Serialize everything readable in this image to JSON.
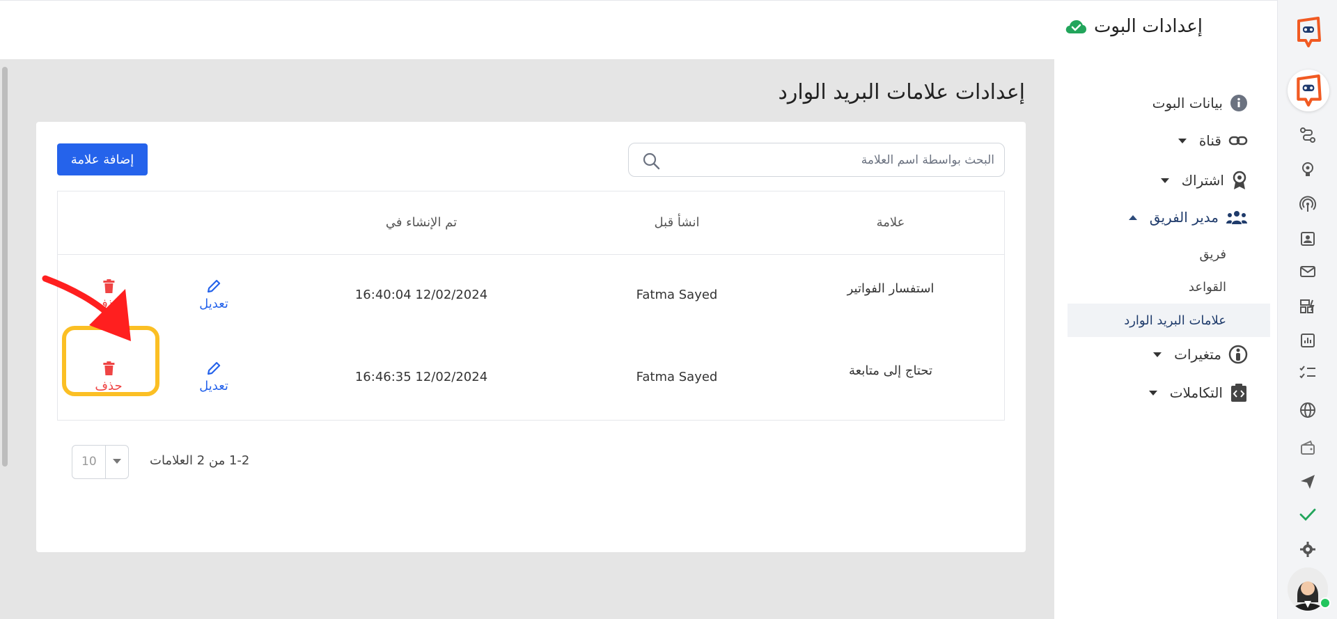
{
  "header": {
    "title": "إعدادات البوت"
  },
  "page": {
    "title": "إعدادات علامات البريد الوارد"
  },
  "toolbar": {
    "add_label": "إضافة علامة",
    "search_placeholder": "البحث بواسطة اسم العلامة"
  },
  "table": {
    "headers": {
      "label": "علامة",
      "created_by": "انشأ قبل",
      "created_at": "تم الإنشاء في"
    },
    "rows": [
      {
        "label": "استفسار الفواتير",
        "created_by": "Fatma Sayed",
        "created_at": "16:40:04 12/02/2024",
        "edit": "تعديل",
        "delete": "حذف"
      },
      {
        "label": "تحتاج إلى متابعة",
        "created_by": "Fatma Sayed",
        "created_at": "16:46:35 12/02/2024",
        "edit": "تعديل",
        "delete": "حذف"
      }
    ]
  },
  "pagination": {
    "summary": "1-2 من 2 العلامات",
    "page_size": "10"
  },
  "menu": {
    "bot_data": "بيانات البوت",
    "channel": "قناة",
    "subscription": "اشتراك",
    "team_manager": "مدير الفريق",
    "team": "فريق",
    "rules": "القواعد",
    "inbox_labels": "علامات البريد الوارد",
    "variables": "متغيرات",
    "integrations": "التكاملات"
  },
  "colors": {
    "primary": "#2563eb",
    "danger": "#ef4444",
    "highlight": "#fbbf24",
    "brand": "#f15a22",
    "online": "#22c55e"
  }
}
